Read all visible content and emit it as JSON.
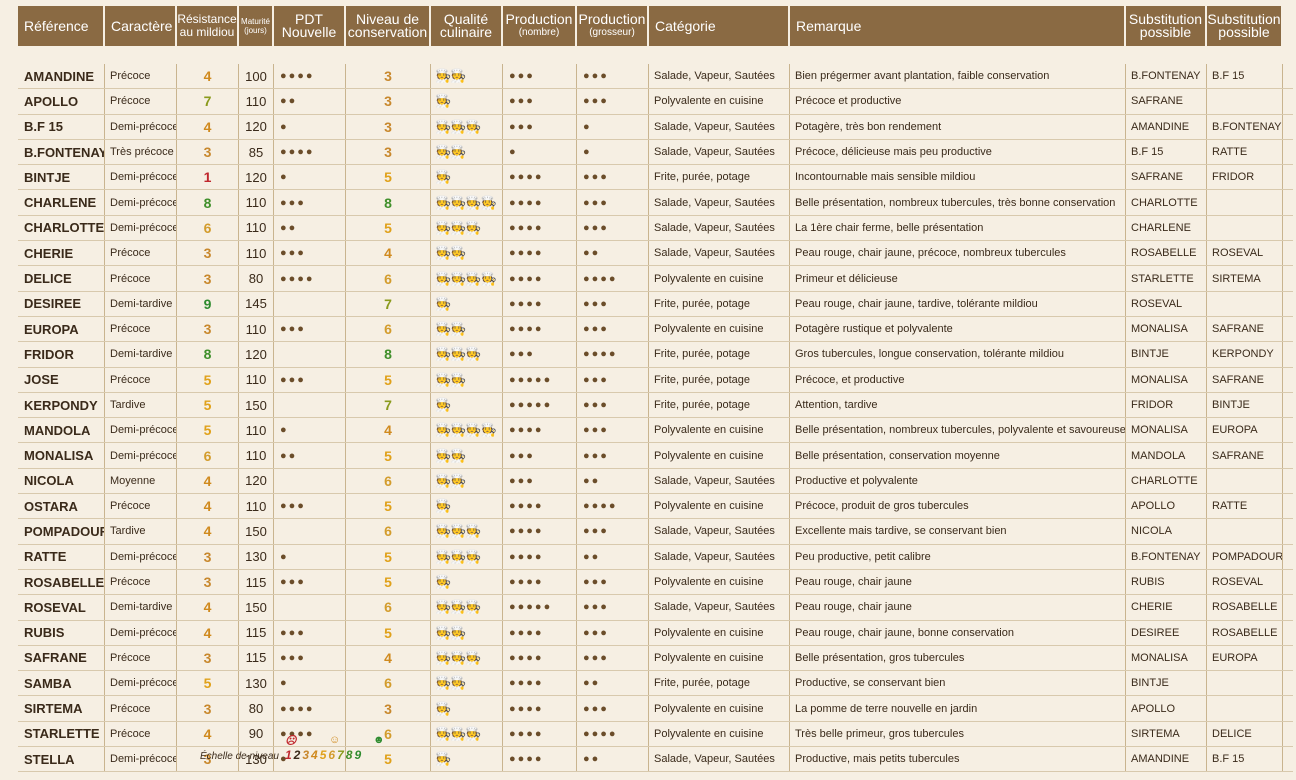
{
  "headers": {
    "reference": "Référence",
    "caractere": "Caractère",
    "resistance_1": "Résistance",
    "resistance_2": "au mildiou",
    "maturite_1": "Maturité",
    "maturite_2": "(jours)",
    "pdt_1": "PDT",
    "pdt_2": "Nouvelle",
    "niveau_1": "Niveau de",
    "niveau_2": "conservation",
    "qualite_1": "Qualité",
    "qualite_2": "culinaire",
    "prod_nombre_1": "Production",
    "prod_nombre_2": "(nombre)",
    "prod_grosseur_1": "Production",
    "prod_grosseur_2": "(grosseur)",
    "categorie": "Catégorie",
    "remarque": "Remarque",
    "sub1_1": "Substitution",
    "sub1_2": "possible",
    "sub2_1": "Substitution",
    "sub2_2": "possible"
  },
  "rows": [
    {
      "ref": "AMANDINE",
      "car": "Précoce",
      "res": "4",
      "mat": "100",
      "pdt": "●●●●",
      "cons": "3",
      "chef": "🧑‍🍳🧑‍🍳",
      "pn": "●●●",
      "pg": "●●●",
      "cat": "Salade, Vapeur, Sautées",
      "rem": "Bien prégermer avant plantation, faible conservation",
      "s1": "B.FONTENAY",
      "s2": "B.F 15"
    },
    {
      "ref": "APOLLO",
      "car": "Précoce",
      "res": "7",
      "mat": "110",
      "pdt": "●●",
      "cons": "3",
      "chef": "🧑‍🍳",
      "pn": "●●●",
      "pg": "●●●",
      "cat": "Polyvalente en cuisine",
      "rem": "Précoce et productive",
      "s1": "SAFRANE",
      "s2": ""
    },
    {
      "ref": "B.F 15",
      "car": "Demi-précoce",
      "res": "4",
      "mat": "120",
      "pdt": "●",
      "cons": "3",
      "chef": "🧑‍🍳🧑‍🍳🧑‍🍳",
      "pn": "●●●",
      "pg": "●",
      "cat": "Salade, Vapeur, Sautées",
      "rem": "Potagère, très bon rendement",
      "s1": "AMANDINE",
      "s2": "B.FONTENAY"
    },
    {
      "ref": "B.FONTENAY",
      "car": "Très précoce",
      "res": "3",
      "mat": "85",
      "pdt": "●●●●",
      "cons": "3",
      "chef": "🧑‍🍳🧑‍🍳",
      "pn": "●",
      "pg": "●",
      "cat": "Salade, Vapeur, Sautées",
      "rem": "Précoce, délicieuse mais peu productive",
      "s1": "B.F 15",
      "s2": "RATTE"
    },
    {
      "ref": "BINTJE",
      "car": "Demi-précoce",
      "res": "1",
      "mat": "120",
      "pdt": "●",
      "cons": "5",
      "chef": "🧑‍🍳",
      "pn": "●●●●",
      "pg": "●●●",
      "cat": "Frite, purée, potage",
      "rem": "Incontournable mais sensible mildiou",
      "s1": "SAFRANE",
      "s2": "FRIDOR"
    },
    {
      "ref": "CHARLENE",
      "car": "Demi-précoce",
      "res": "8",
      "mat": "110",
      "pdt": "●●●",
      "cons": "8",
      "chef": "🧑‍🍳🧑‍🍳🧑‍🍳🧑‍🍳",
      "pn": "●●●●",
      "pg": "●●●",
      "cat": "Salade, Vapeur, Sautées",
      "rem": "Belle présentation, nombreux tubercules, très bonne conservation",
      "s1": "CHARLOTTE",
      "s2": ""
    },
    {
      "ref": "CHARLOTTE",
      "car": "Demi-précoce",
      "res": "6",
      "mat": "110",
      "pdt": "●●",
      "cons": "5",
      "chef": "🧑‍🍳🧑‍🍳🧑‍🍳",
      "pn": "●●●●",
      "pg": "●●●",
      "cat": "Salade, Vapeur, Sautées",
      "rem": "La 1ère chair ferme, belle présentation",
      "s1": "CHARLENE",
      "s2": ""
    },
    {
      "ref": "CHERIE",
      "car": "Précoce",
      "res": "3",
      "mat": "110",
      "pdt": "●●●",
      "cons": "4",
      "chef": "🧑‍🍳🧑‍🍳",
      "pn": "●●●●",
      "pg": "●●",
      "cat": "Salade, Vapeur, Sautées",
      "rem": "Peau rouge, chair jaune, précoce, nombreux tubercules",
      "s1": "ROSABELLE",
      "s2": "ROSEVAL"
    },
    {
      "ref": "DELICE",
      "car": "Précoce",
      "res": "3",
      "mat": "80",
      "pdt": "●●●●",
      "cons": "6",
      "chef": "🧑‍🍳🧑‍🍳🧑‍🍳🧑‍🍳",
      "pn": "●●●●",
      "pg": "●●●●",
      "cat": "Polyvalente en cuisine",
      "rem": "Primeur et délicieuse",
      "s1": "STARLETTE",
      "s2": "SIRTEMA"
    },
    {
      "ref": "DESIREE",
      "car": "Demi-tardive",
      "res": "9",
      "mat": "145",
      "pdt": "",
      "cons": "7",
      "chef": "🧑‍🍳",
      "pn": "●●●●",
      "pg": "●●●",
      "cat": "Frite, purée, potage",
      "rem": "Peau rouge, chair jaune, tardive, tolérante mildiou",
      "s1": "ROSEVAL",
      "s2": ""
    },
    {
      "ref": "EUROPA",
      "car": "Précoce",
      "res": "3",
      "mat": "110",
      "pdt": "●●●",
      "cons": "6",
      "chef": "🧑‍🍳🧑‍🍳",
      "pn": "●●●●",
      "pg": "●●●",
      "cat": "Polyvalente en cuisine",
      "rem": "Potagère rustique et polyvalente",
      "s1": "MONALISA",
      "s2": "SAFRANE"
    },
    {
      "ref": "FRIDOR",
      "car": "Demi-tardive",
      "res": "8",
      "mat": "120",
      "pdt": "",
      "cons": "8",
      "chef": "🧑‍🍳🧑‍🍳🧑‍🍳",
      "pn": "●●●",
      "pg": "●●●●",
      "cat": "Frite, purée, potage",
      "rem": "Gros tubercules, longue conservation, tolérante mildiou",
      "s1": "BINTJE",
      "s2": "KERPONDY"
    },
    {
      "ref": "JOSE",
      "car": "Précoce",
      "res": "5",
      "mat": "110",
      "pdt": "●●●",
      "cons": "5",
      "chef": "🧑‍🍳🧑‍🍳",
      "pn": "●●●●●",
      "pg": "●●●",
      "cat": "Frite, purée, potage",
      "rem": "Précoce, et productive",
      "s1": "MONALISA",
      "s2": "SAFRANE"
    },
    {
      "ref": "KERPONDY",
      "car": "Tardive",
      "res": "5",
      "mat": "150",
      "pdt": "",
      "cons": "7",
      "chef": "🧑‍🍳",
      "pn": "●●●●●",
      "pg": "●●●",
      "cat": "Frite, purée, potage",
      "rem": "Attention, tardive",
      "s1": "FRIDOR",
      "s2": "BINTJE"
    },
    {
      "ref": "MANDOLA",
      "car": "Demi-précoce",
      "res": "5",
      "mat": "110",
      "pdt": "●",
      "cons": "4",
      "chef": "🧑‍🍳🧑‍🍳🧑‍🍳🧑‍🍳",
      "pn": "●●●●",
      "pg": "●●●",
      "cat": "Polyvalente en cuisine",
      "rem": "Belle présentation, nombreux tubercules, polyvalente et savoureuse",
      "s1": "MONALISA",
      "s2": "EUROPA"
    },
    {
      "ref": "MONALISA",
      "car": "Demi-précoce",
      "res": "6",
      "mat": "110",
      "pdt": "●●",
      "cons": "5",
      "chef": "🧑‍🍳🧑‍🍳",
      "pn": "●●●",
      "pg": "●●●",
      "cat": "Polyvalente en cuisine",
      "rem": "Belle présentation, conservation moyenne",
      "s1": "MANDOLA",
      "s2": "SAFRANE"
    },
    {
      "ref": "NICOLA",
      "car": "Moyenne",
      "res": "4",
      "mat": "120",
      "pdt": "",
      "cons": "6",
      "chef": "🧑‍🍳🧑‍🍳",
      "pn": "●●●",
      "pg": "●●",
      "cat": "Salade, Vapeur, Sautées",
      "rem": "Productive et polyvalente",
      "s1": "CHARLOTTE",
      "s2": ""
    },
    {
      "ref": "OSTARA",
      "car": "Précoce",
      "res": "4",
      "mat": "110",
      "pdt": "●●●",
      "cons": "5",
      "chef": "🧑‍🍳",
      "pn": "●●●●",
      "pg": "●●●●",
      "cat": "Polyvalente en cuisine",
      "rem": "Précoce, produit de gros tubercules",
      "s1": "APOLLO",
      "s2": "RATTE"
    },
    {
      "ref": "POMPADOUR",
      "car": "Tardive",
      "res": "4",
      "mat": "150",
      "pdt": "",
      "cons": "6",
      "chef": "🧑‍🍳🧑‍🍳🧑‍🍳",
      "pn": "●●●●",
      "pg": "●●●",
      "cat": "Salade, Vapeur, Sautées",
      "rem": "Excellente mais tardive, se conservant bien",
      "s1": "NICOLA",
      "s2": ""
    },
    {
      "ref": "RATTE",
      "car": "Demi-précoce",
      "res": "3",
      "mat": "130",
      "pdt": "●",
      "cons": "5",
      "chef": "🧑‍🍳🧑‍🍳🧑‍🍳",
      "pn": "●●●●",
      "pg": "●●",
      "cat": "Salade, Vapeur, Sautées",
      "rem": "Peu productive, petit calibre",
      "s1": "B.FONTENAY",
      "s2": "POMPADOUR"
    },
    {
      "ref": "ROSABELLE",
      "car": "Précoce",
      "res": "3",
      "mat": "115",
      "pdt": "●●●",
      "cons": "5",
      "chef": "🧑‍🍳",
      "pn": "●●●●",
      "pg": "●●●",
      "cat": "Polyvalente en cuisine",
      "rem": "Peau rouge, chair jaune",
      "s1": "RUBIS",
      "s2": "ROSEVAL"
    },
    {
      "ref": "ROSEVAL",
      "car": "Demi-tardive",
      "res": "4",
      "mat": "150",
      "pdt": "",
      "cons": "6",
      "chef": "🧑‍🍳🧑‍🍳🧑‍🍳",
      "pn": "●●●●●",
      "pg": "●●●",
      "cat": "Salade, Vapeur, Sautées",
      "rem": "Peau rouge, chair jaune",
      "s1": "CHERIE",
      "s2": "ROSABELLE"
    },
    {
      "ref": "RUBIS",
      "car": "Demi-précoce",
      "res": "4",
      "mat": "115",
      "pdt": "●●●",
      "cons": "5",
      "chef": "🧑‍🍳🧑‍🍳",
      "pn": "●●●●",
      "pg": "●●●",
      "cat": "Polyvalente en cuisine",
      "rem": "Peau rouge, chair jaune, bonne conservation",
      "s1": "DESIREE",
      "s2": "ROSABELLE"
    },
    {
      "ref": "SAFRANE",
      "car": "Précoce",
      "res": "3",
      "mat": "115",
      "pdt": "●●●",
      "cons": "4",
      "chef": "🧑‍🍳🧑‍🍳🧑‍🍳",
      "pn": "●●●●",
      "pg": "●●●",
      "cat": "Polyvalente en cuisine",
      "rem": "Belle présentation, gros tubercules",
      "s1": "MONALISA",
      "s2": "EUROPA"
    },
    {
      "ref": "SAMBA",
      "car": "Demi-précoce",
      "res": "5",
      "mat": "130",
      "pdt": "●",
      "cons": "6",
      "chef": "🧑‍🍳🧑‍🍳",
      "pn": "●●●●",
      "pg": "●●",
      "cat": "Frite, purée, potage",
      "rem": "Productive, se conservant bien",
      "s1": "BINTJE",
      "s2": ""
    },
    {
      "ref": "SIRTEMA",
      "car": "Précoce",
      "res": "3",
      "mat": "80",
      "pdt": "●●●●",
      "cons": "3",
      "chef": "🧑‍🍳",
      "pn": "●●●●",
      "pg": "●●●",
      "cat": "Polyvalente en cuisine",
      "rem": "La pomme de terre nouvelle en jardin",
      "s1": "APOLLO",
      "s2": ""
    },
    {
      "ref": "STARLETTE",
      "car": "Précoce",
      "res": "4",
      "mat": "90",
      "pdt": "●●●●",
      "cons": "6",
      "chef": "🧑‍🍳🧑‍🍳🧑‍🍳",
      "pn": "●●●●",
      "pg": "●●●●",
      "cat": "Polyvalente en cuisine",
      "rem": "Très belle primeur, gros tubercules",
      "s1": "SIRTEMA",
      "s2": "DELICE"
    },
    {
      "ref": "STELLA",
      "car": "Demi-précoce",
      "res": "3",
      "mat": "130",
      "pdt": "●",
      "cons": "5",
      "chef": "🧑‍🍳",
      "pn": "●●●●",
      "pg": "●●",
      "cat": "Salade, Vapeur, Sautées",
      "rem": "Productive, mais petits tubercules",
      "s1": "AMANDINE",
      "s2": "B.F 15"
    }
  ],
  "scale": {
    "label": "Échelle de niveau",
    "values": [
      "1",
      "2",
      "3",
      "4",
      "5",
      "6",
      "7",
      "8",
      "9"
    ],
    "face_bad": "☹",
    "face_mid": "☺",
    "face_good": "☻"
  }
}
